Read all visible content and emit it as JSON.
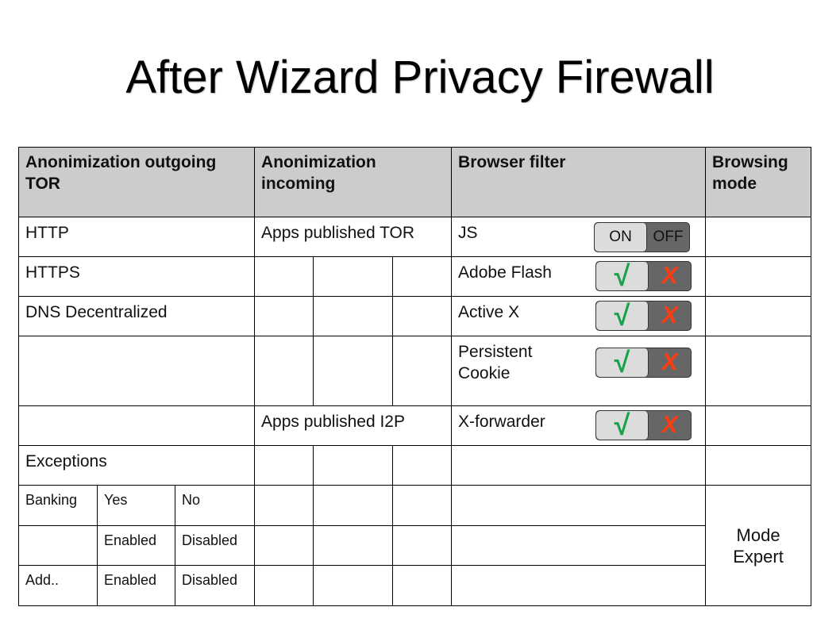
{
  "title": "After Wizard Privacy Firewall",
  "headers": {
    "outgoing": "Anonimization outgoing TOR",
    "incoming": "Anonimization incoming",
    "browser_filter": "Browser filter",
    "browsing_mode": "Browsing mode"
  },
  "outgoing": {
    "http": "HTTP",
    "https": "HTTPS",
    "dns": "DNS Decentralized",
    "exceptions": "Exceptions",
    "exception_rows": [
      {
        "name": "Banking",
        "on": "Yes",
        "off": "No"
      },
      {
        "name": "",
        "on": "Enabled",
        "off": "Disabled"
      },
      {
        "name": "Add..",
        "on": "Enabled",
        "off": "Disabled"
      }
    ]
  },
  "incoming": {
    "tor": "Apps published TOR",
    "i2p": "Apps published I2P"
  },
  "filters": [
    {
      "label": "JS",
      "on": "ON",
      "off": "OFF",
      "state": "on"
    },
    {
      "label": "Adobe Flash",
      "on": "√",
      "off": "X",
      "state": "on"
    },
    {
      "label": "Active X",
      "on": "√",
      "off": "X",
      "state": "on"
    },
    {
      "label": "Persistent Cookie",
      "on": "√",
      "off": "X",
      "state": "on"
    },
    {
      "label": "X-forwarder",
      "on": "√",
      "off": "X",
      "state": "on"
    }
  ],
  "browsing_mode": {
    "value": "Mode Expert"
  },
  "colors": {
    "header_bg": "#cccccc",
    "toggle_on_bg": "#dcdcdc",
    "toggle_off_bg": "#666666",
    "check": "#18a24a",
    "cross": "#ff3c10"
  }
}
